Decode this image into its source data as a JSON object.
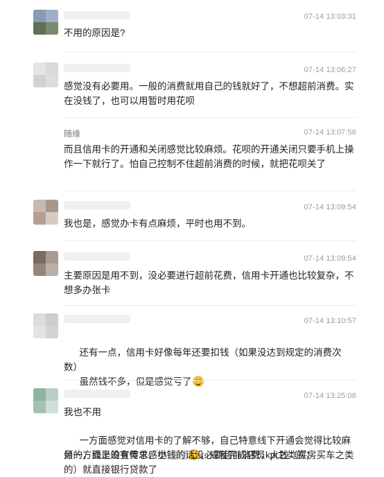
{
  "comments": [
    {
      "time": "07-14 13:03:31",
      "text": "不用的原因是?",
      "avatar_colors": [
        "#8a9bb7",
        "#9fb0c8",
        "#5f6f58",
        "#7a8a6e"
      ]
    },
    {
      "time": "07-14 13:06:27",
      "text": "感觉没有必要用。一般的消费就用自己的钱就好了，不想超前消费。实在没钱了，也可以用暂时用花呗",
      "avatar_colors": [
        "#e3e4e6",
        "#d7d9db",
        "#cfd1d3",
        "#dcdde0"
      ]
    },
    {
      "name": "随缘",
      "time": "07-14 13:07:56",
      "text": "而且信用卡的开通和关闭感觉比较麻烦。花呗的开通关闭只要手机上操作一下就行了。怕自己控制不住超前消费的时候，就把花呗关了"
    },
    {
      "time": "07-14 13:09:54",
      "text": "我也是，感觉办卡有点麻烦，平时也用不到。",
      "avatar_colors": [
        "#c8b9ae",
        "#a8978a",
        "#b59f91",
        "#d6cbc3"
      ]
    },
    {
      "time": "07-14 13:09:54",
      "text": "主要原因是用不到，没必要进行超前花费，信用卡开通也比较复杂，不想多办张卡",
      "avatar_colors": [
        "#7a6b60",
        "#a89a90",
        "#93867c",
        "#b9afa8"
      ]
    },
    {
      "time": "07-14 13:10:57",
      "text_lines": [
        "还有一点，信用卡好像每年还要扣钱（如果没达到规定的消费次数）",
        "虽然钱不多，但是感觉亏了"
      ],
      "avatar_colors": [
        "#dadcdd",
        "#cbcdce",
        "#e2e3e4",
        "#d2d4d5"
      ]
    },
    {
      "time": "07-14 13:25:06",
      "line1": "我也不用",
      "line2": "一方面感觉对信用卡的了解不够，自己特意线下开通会觉得比较麻烦的，线上的宣传总感觉",
      "line2b": "，或者完成店员kpi之类的；",
      "line3": "另一方面是没有需求，小钱的话没必要超前消费，大钱（买房买车之类的）就直接银行贷款了",
      "avatar_colors": [
        "#8fb3a0",
        "#b8d0c3",
        "#a3c2b2",
        "#cfe0d7"
      ]
    }
  ]
}
